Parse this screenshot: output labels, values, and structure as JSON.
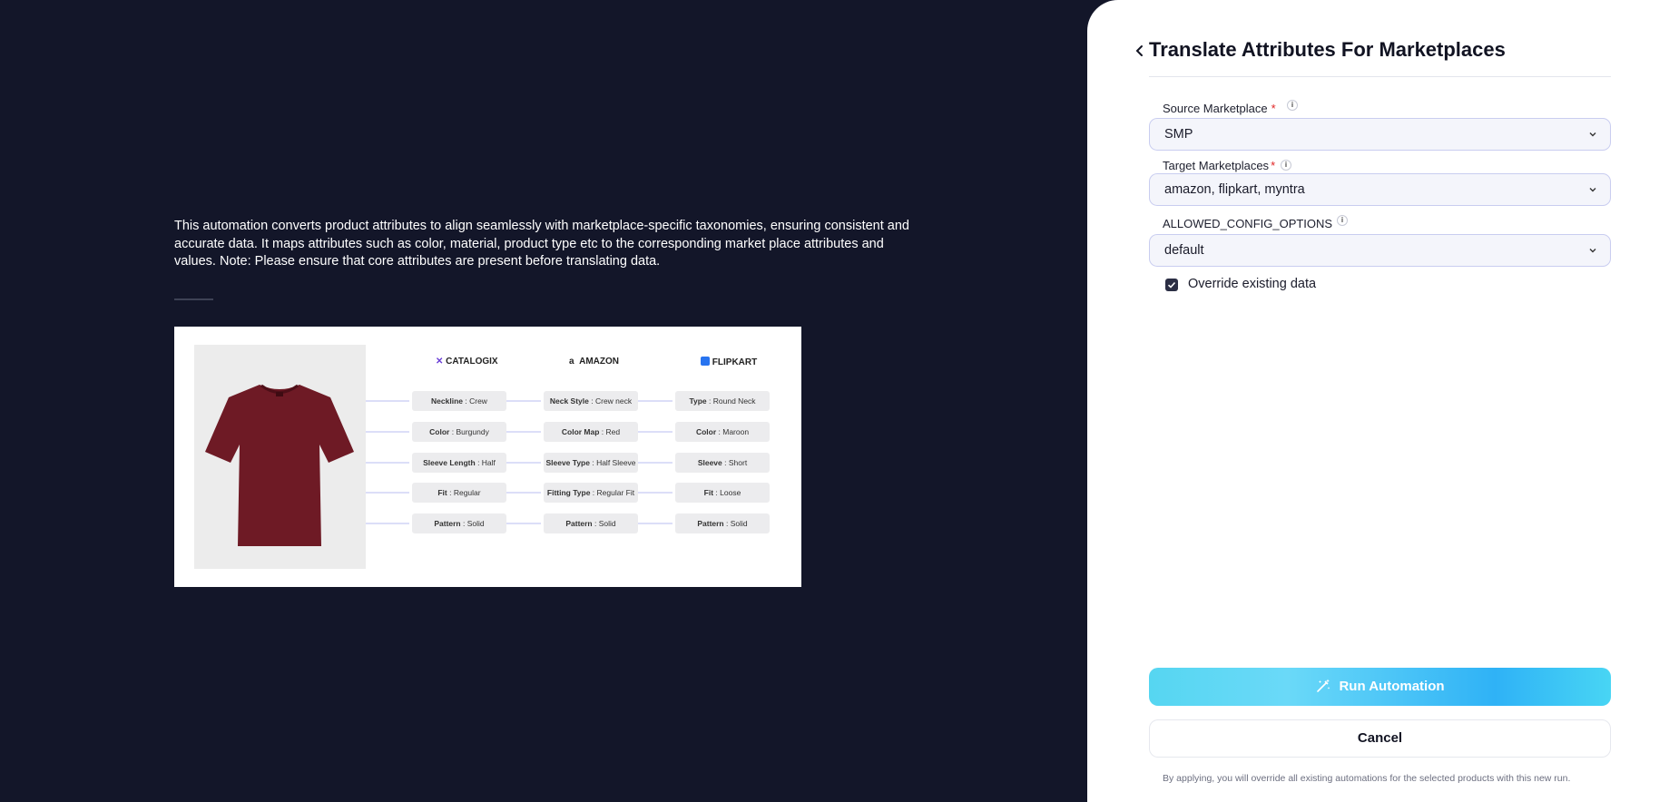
{
  "description": "This automation converts product attributes to align seamlessly with marketplace-specific taxonomies, ensuring consistent and accurate data. It maps attributes such as color, material, product type etc to the corresponding market place attributes and values. Note: Please ensure that core attributes are present before translating data.",
  "illustration": {
    "columns": [
      "CATALOGIX",
      "AMAZON",
      "FLIPKART"
    ],
    "rows": [
      [
        {
          "k": "Neckline",
          "v": "Crew"
        },
        {
          "k": "Neck Style",
          "v": "Crew neck"
        },
        {
          "k": "Type",
          "v": "Round Neck"
        }
      ],
      [
        {
          "k": "Color",
          "v": "Burgundy"
        },
        {
          "k": "Color Map",
          "v": "Red"
        },
        {
          "k": "Color",
          "v": "Maroon"
        }
      ],
      [
        {
          "k": "Sleeve Length",
          "v": "Half"
        },
        {
          "k": "Sleeve Type",
          "v": "Half Sleeve"
        },
        {
          "k": "Sleeve",
          "v": "Short"
        }
      ],
      [
        {
          "k": "Fit",
          "v": "Regular"
        },
        {
          "k": "Fitting Type",
          "v": "Regular Fit"
        },
        {
          "k": "Fit",
          "v": "Loose"
        }
      ],
      [
        {
          "k": "Pattern",
          "v": "Solid"
        },
        {
          "k": "Pattern",
          "v": "Solid"
        },
        {
          "k": "Pattern",
          "v": "Solid"
        }
      ]
    ],
    "shirt_color": "#6e1a25"
  },
  "panel": {
    "title": "Translate Attributes For Marketplaces",
    "source": {
      "label": "Source Marketplace",
      "required": "*",
      "value": "SMP"
    },
    "target": {
      "label": "Target Marketplaces",
      "required": "*",
      "value": "amazon, flipkart, myntra"
    },
    "config": {
      "label": "ALLOWED_CONFIG_OPTIONS",
      "value": "default"
    },
    "override": {
      "label": "Override existing data",
      "checked": true
    },
    "run_label": "Run Automation",
    "cancel_label": "Cancel",
    "footer_note": "By applying, you will override all existing automations for the selected products with this new run."
  },
  "colors": {
    "background": "#131629",
    "accent": "#4cd2f5",
    "required": "#e02424"
  }
}
